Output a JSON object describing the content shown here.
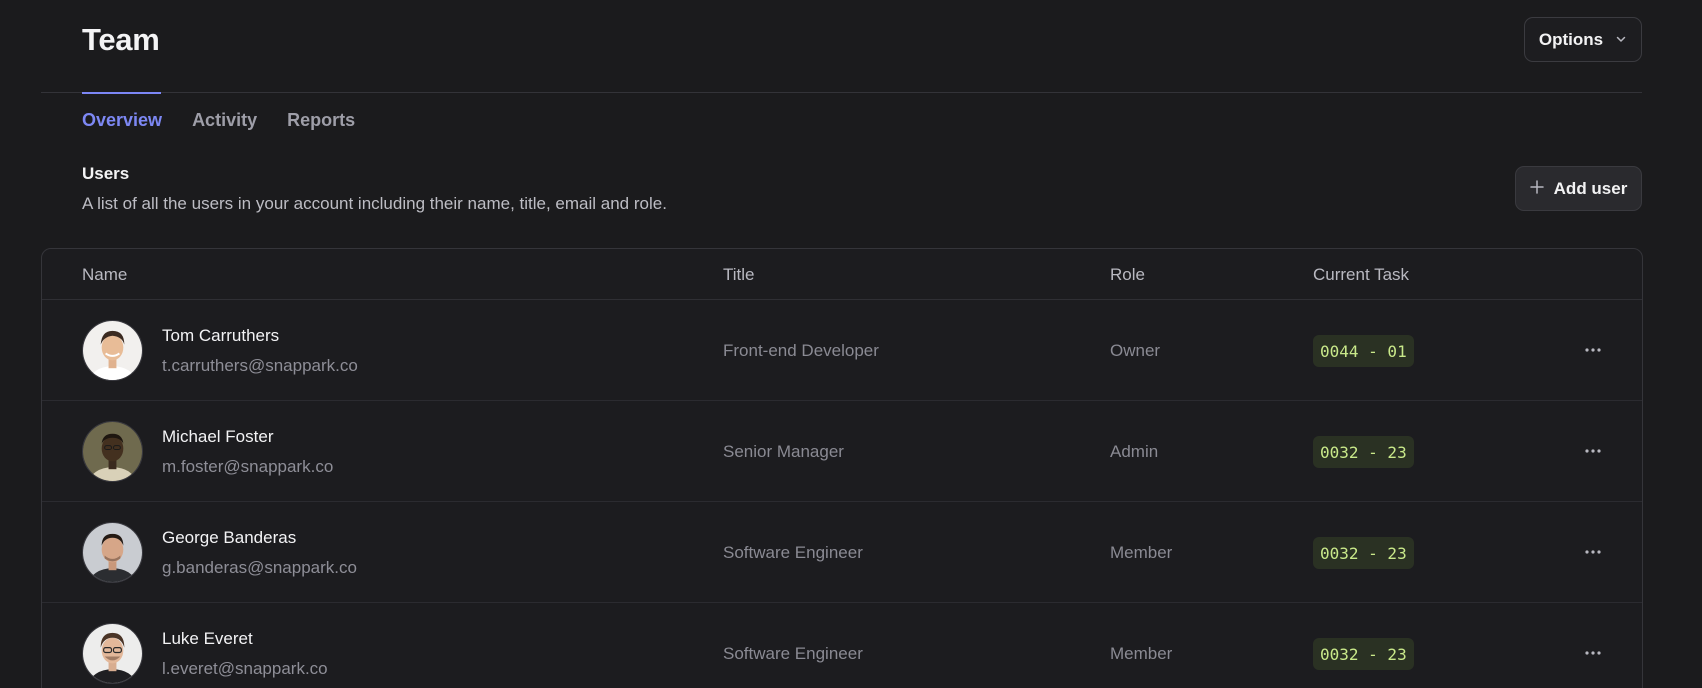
{
  "header": {
    "title": "Team",
    "options_label": "Options"
  },
  "tabs": [
    {
      "label": "Overview",
      "active": true
    },
    {
      "label": "Activity",
      "active": false
    },
    {
      "label": "Reports",
      "active": false
    }
  ],
  "section": {
    "title": "Users",
    "description": "A list of all the users in your account including their name, title, email and role.",
    "add_button_label": "Add user"
  },
  "table": {
    "columns": [
      "Name",
      "Title",
      "Role",
      "Current Task"
    ],
    "rows": [
      {
        "name": "Tom Carruthers",
        "email": "t.carruthers@snappark.co",
        "title": "Front-end Developer",
        "role": "Owner",
        "task": "0044 - 01"
      },
      {
        "name": "Michael Foster",
        "email": "m.foster@snappark.co",
        "title": "Senior Manager",
        "role": "Admin",
        "task": "0032 - 23"
      },
      {
        "name": "George Banderas",
        "email": "g.banderas@snappark.co",
        "title": "Software Engineer",
        "role": "Member",
        "task": "0032 - 23"
      },
      {
        "name": "Luke Everet",
        "email": "l.everet@snappark.co",
        "title": "Software Engineer",
        "role": "Member",
        "task": "0032 - 23"
      }
    ]
  },
  "colors": {
    "background": "#1b1b1d",
    "accent": "#7d88f4",
    "task_badge_bg": "#2a3123",
    "task_badge_text": "#c9e98a"
  },
  "icons": {
    "options": "chevron-down-icon",
    "add_user": "plus-icon",
    "row_menu": "ellipsis-icon"
  }
}
